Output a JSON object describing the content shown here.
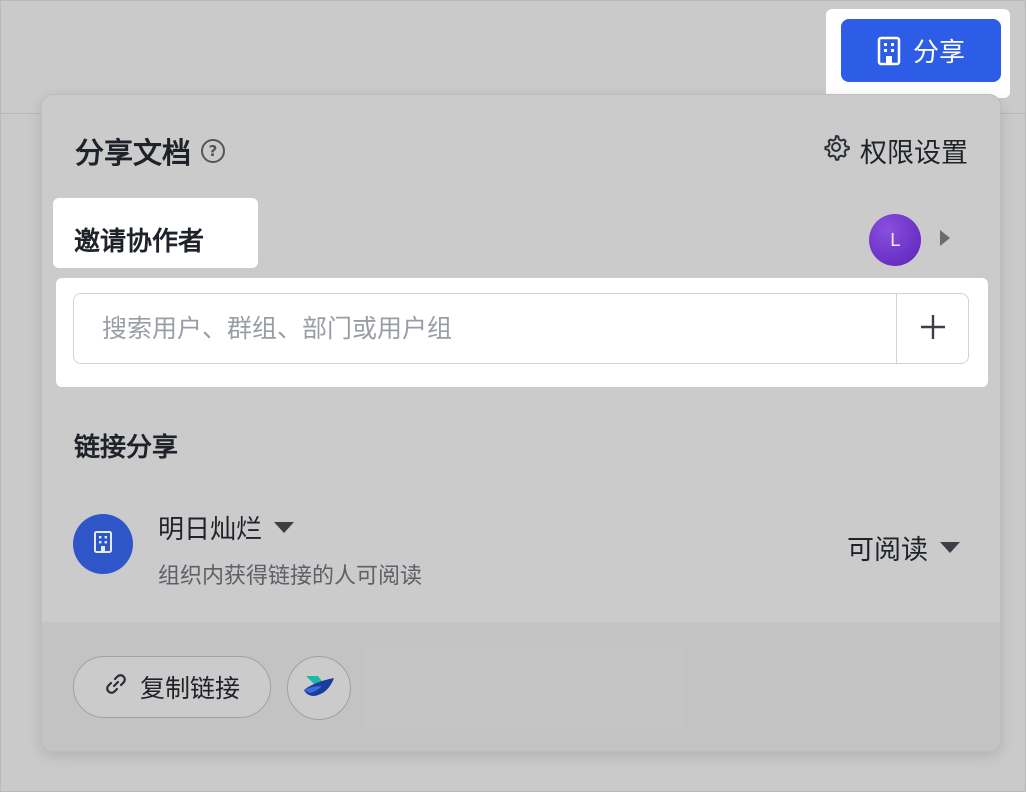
{
  "header": {
    "share_button_label": "分享"
  },
  "panel": {
    "title": "分享文档",
    "help_icon_glyph": "?",
    "permission_settings_label": "权限设置",
    "invite": {
      "label": "邀请协作者",
      "avatar_letter": "L",
      "search_placeholder": "搜索用户、群组、部门或用户组"
    },
    "link_share": {
      "label": "链接分享",
      "org_name": "明日灿烂",
      "org_description": "组织内获得链接的人可阅读",
      "access_level": "可阅读"
    },
    "footer": {
      "copy_link_label": "复制链接"
    }
  },
  "colors": {
    "primary": "#2d5ce6",
    "avatar": "#6a2fc8",
    "org_icon": "#2f56c9"
  },
  "icons": [
    "building-icon",
    "help-icon",
    "gear-icon",
    "plus-icon",
    "caret-down-icon",
    "caret-right-icon",
    "link-icon",
    "lark-icon"
  ]
}
